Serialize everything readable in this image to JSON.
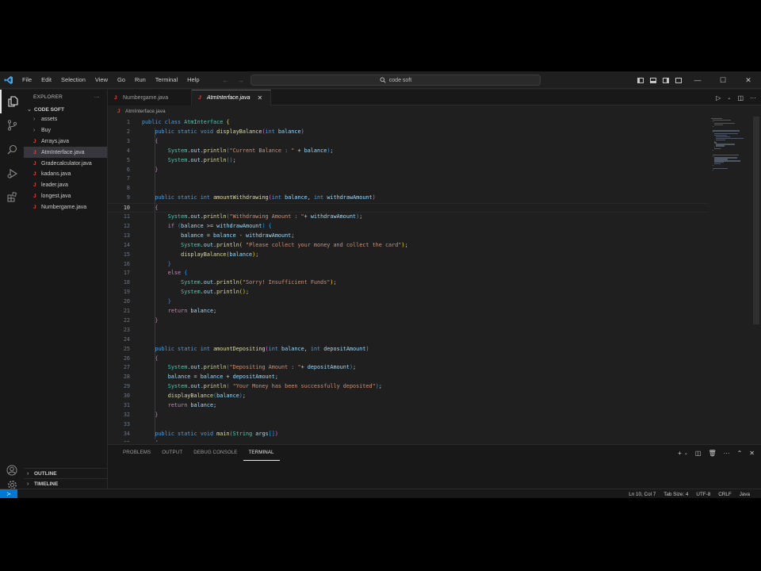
{
  "titlebar": {
    "menu": [
      "File",
      "Edit",
      "Selection",
      "View",
      "Go",
      "Run",
      "Terminal",
      "Help"
    ],
    "search": "code soft"
  },
  "sidebar": {
    "header": "EXPLORER",
    "folder": "CODE SOFT",
    "items": [
      {
        "label": "assets",
        "type": "folder"
      },
      {
        "label": "Buy",
        "type": "folder"
      },
      {
        "label": "Arrays.java",
        "type": "java"
      },
      {
        "label": "AtmInterface.java",
        "type": "java",
        "selected": true
      },
      {
        "label": "Gradecalculator.java",
        "type": "java"
      },
      {
        "label": "kadans.java",
        "type": "java"
      },
      {
        "label": "leader.java",
        "type": "java"
      },
      {
        "label": "longest.java",
        "type": "java"
      },
      {
        "label": "Numbergame.java",
        "type": "java"
      }
    ],
    "outline": "OUTLINE",
    "timeline": "TIMELINE"
  },
  "tabs": [
    {
      "label": "Numbergame.java",
      "active": false
    },
    {
      "label": "AtmInterface.java",
      "active": true
    }
  ],
  "breadcrumb": "AtmInterface.java",
  "editor": {
    "current_line": 10,
    "lines": [
      "public class AtmInterface {",
      "    public static void displayBalance(int balance)",
      "    {",
      "        System.out.println(\"Current Balance : \" + balance);",
      "        System.out.println();",
      "    }",
      "",
      "",
      "    public static int amountWithdrawing(int balance, int withdrawAmount)",
      "    {",
      "        System.out.println(\"Withdrawing Amount : \"+ withdrawAmount);",
      "        if (balance >= withdrawAmount) {",
      "            balance = balance - withdrawAmount;",
      "            System.out.println( \"Please collect your money and collect the card\");",
      "            displayBalance(balance);",
      "        }",
      "        else {",
      "            System.out.println(\"Sorry! Insufficient Funds\");",
      "            System.out.println();",
      "        }",
      "        return balance;",
      "    }",
      "",
      "",
      "    public static int amountDepositing(int balance, int depositAmount)",
      "    {",
      "        System.out.println(\"Depositing Amount : \"+ depositAmount);",
      "        balance = balance + depositAmount;",
      "        System.out.println( \"Your Money has been successfully deposited\");",
      "        displayBalance(balance);",
      "        return balance;",
      "    }",
      "",
      "    public static void main(String args[])",
      "    {"
    ]
  },
  "panel": {
    "tabs": [
      "PROBLEMS",
      "OUTPUT",
      "DEBUG CONSOLE",
      "TERMINAL"
    ],
    "active_tab": "TERMINAL"
  },
  "status": {
    "position": "Ln 10, Col 7",
    "tab_size": "Tab Size: 4",
    "encoding": "UTF-8",
    "eol": "CRLF",
    "language": "Java"
  },
  "colors": {
    "accent": "#0078d4",
    "keyword": "#569cd6",
    "type": "#4ec9b0",
    "function": "#dcdcaa",
    "variable": "#9cdcfe",
    "string": "#ce9178",
    "control": "#c586c0",
    "java_icon": "#e4453a"
  }
}
